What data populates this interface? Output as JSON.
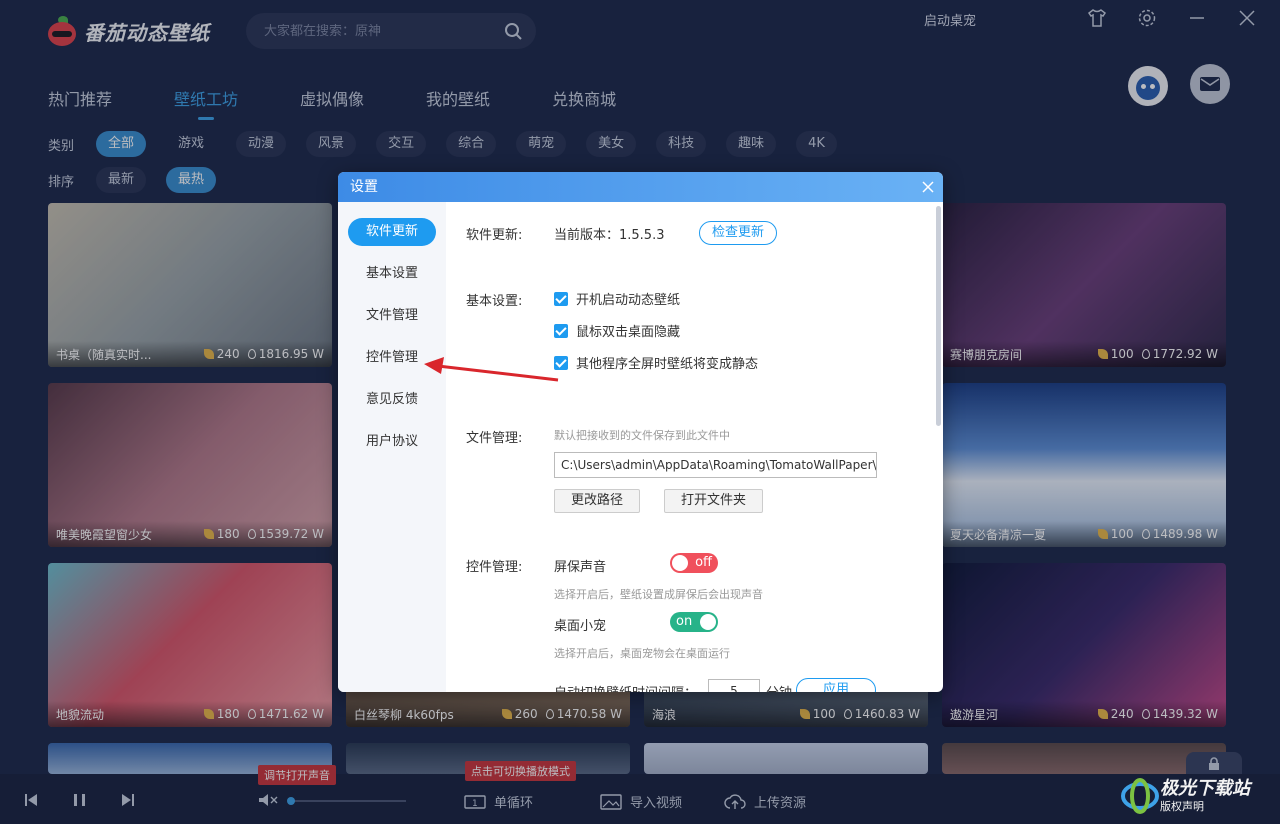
{
  "app": {
    "name": "番茄动态壁纸",
    "search_placeholder": "大家都在搜索：原神",
    "top_right_label": "启动桌宠"
  },
  "tabs": [
    {
      "label": "热门推荐"
    },
    {
      "label": "壁纸工坊"
    },
    {
      "label": "虚拟偶像"
    },
    {
      "label": "我的壁纸"
    },
    {
      "label": "兑换商城"
    }
  ],
  "filters": {
    "category_label": "类别",
    "categories": [
      "全部",
      "游戏",
      "动漫",
      "风景",
      "交互",
      "综合",
      "萌宠",
      "美女",
      "科技",
      "趣味",
      "4K"
    ],
    "sort_label": "排序",
    "sorts": [
      "最新",
      "最热"
    ]
  },
  "wallpapers": [
    {
      "title": "书桌（随真实时...",
      "likes": "240",
      "size": "1816.95 W"
    },
    {
      "title": "赛博朋克房间",
      "likes": "100",
      "size": "1772.92 W"
    },
    {
      "title": "唯美晚霞望窗少女",
      "likes": "180",
      "size": "1539.72 W"
    },
    {
      "title": "夏天必备清凉一夏",
      "likes": "100",
      "size": "1489.98 W"
    },
    {
      "title": "地貌流动",
      "likes": "180",
      "size": "1471.62 W"
    },
    {
      "title": "白丝琴柳 4k60fps",
      "likes": "260",
      "size": "1470.58 W"
    },
    {
      "title": "海浪",
      "likes": "100",
      "size": "1460.83 W"
    },
    {
      "title": "遨游星河",
      "likes": "240",
      "size": "1439.32 W"
    }
  ],
  "bottom": {
    "sound_tooltip": "调节打开声音",
    "mode_tooltip": "点击可切换播放模式",
    "loop_label": "单循环",
    "import_label": "导入视频",
    "upload_label": "上传资源"
  },
  "dialog": {
    "title": "设置",
    "side": [
      "软件更新",
      "基本设置",
      "文件管理",
      "控件管理",
      "意见反馈",
      "用户协议"
    ],
    "update_label": "软件更新:",
    "version_text": "当前版本：1.5.5.3",
    "check_update": "检查更新",
    "basic_label": "基本设置:",
    "basic_options": [
      "开机启动动态壁纸",
      "鼠标双击桌面隐藏",
      "其他程序全屏时壁纸将变成静态"
    ],
    "file_label": "文件管理:",
    "file_hint": "默认把接收到的文件保存到此文件中",
    "file_path": "C:\\Users\\admin\\AppData\\Roaming\\TomatoWallPaper\\c",
    "change_path": "更改路径",
    "open_folder": "打开文件夹",
    "control_label": "控件管理:",
    "screensaver_sound": "屏保声音",
    "screensaver_state": "off",
    "screensaver_hint": "选择开启后，壁纸设置成屏保后会出现声音",
    "desktop_pet": "桌面小宠",
    "desktop_pet_state": "on",
    "desktop_pet_hint": "选择开启后，桌面宠物会在桌面运行",
    "auto_switch_label": "自动切换壁纸时间间隔：",
    "auto_switch_value": "5",
    "auto_switch_unit": "分钟",
    "apply": "应用"
  },
  "watermark": {
    "brand": "极光下载站",
    "sub": "版权声明"
  },
  "colors": {
    "accent": "#1e9bf0",
    "background": "#1e2a4b",
    "toggle_off": "#f0505c",
    "toggle_on": "#27b389",
    "annotation_arrow": "#d9262c"
  }
}
